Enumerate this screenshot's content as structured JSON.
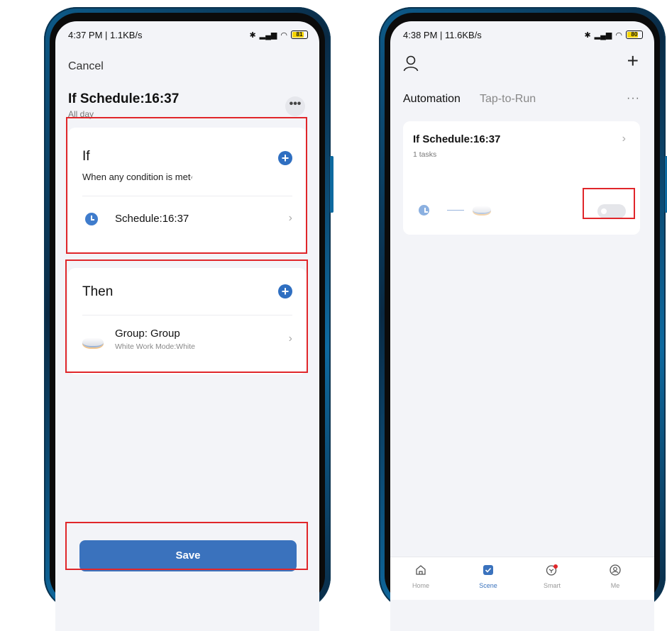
{
  "left_phone": {
    "status": {
      "time_info": "4:37 PM | 1.1KB/s",
      "icons": "ⅹ◔",
      "battery": "81"
    },
    "cancel_label": "Cancel",
    "title": "If Schedule:16:37",
    "subtitle": "All day",
    "more_label": "•••",
    "if_card": {
      "title": "If",
      "condition_mode": "When any condition is met",
      "items": [
        {
          "label": "Schedule:16:37",
          "icon": "clock-icon"
        }
      ]
    },
    "then_card": {
      "title": "Then",
      "items": [
        {
          "label": "Group: Group",
          "sublabel": "White Work Mode:White",
          "icon": "ceiling-light-icon"
        }
      ]
    },
    "save_label": "Save"
  },
  "right_phone": {
    "status": {
      "time_info": "4:38 PM | 11.6KB/s",
      "icons": "ⅹ◔",
      "battery": "80"
    },
    "tabs": [
      {
        "label": "Automation",
        "active": true
      },
      {
        "label": "Tap-to-Run",
        "active": false
      }
    ],
    "more_label": "···",
    "automation": {
      "title": "If Schedule:16:37",
      "subtitle": "1 tasks",
      "enabled": false
    },
    "tabbar": [
      {
        "label": "Home",
        "icon": "home-icon",
        "active": false
      },
      {
        "label": "Scene",
        "icon": "scene-check-icon",
        "active": true
      },
      {
        "label": "Smart",
        "icon": "smart-cube-icon",
        "active": false
      },
      {
        "label": "Me",
        "icon": "user-circle-icon",
        "active": false
      }
    ]
  },
  "colors": {
    "accent": "#3a72bd",
    "highlight_box": "#e0262a",
    "background": "#f3f4f8"
  }
}
